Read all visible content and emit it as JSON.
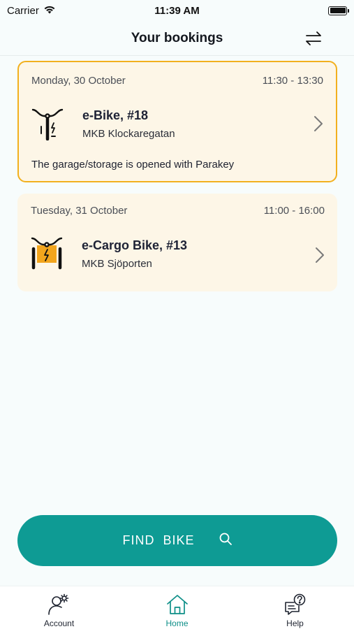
{
  "status_bar": {
    "carrier": "Carrier",
    "time": "11:39 AM",
    "battery_level": 1.0
  },
  "header": {
    "title": "Your bookings",
    "swap_icon": "swap-arrows-icon"
  },
  "bookings": [
    {
      "date": "Monday, 30 October",
      "time": "11:30 - 13:30",
      "bike": "e-Bike, #18",
      "location": "MKB Klockaregatan",
      "note": "The garage/storage is opened with Parakey",
      "icon": "e-bike-icon",
      "selected": true
    },
    {
      "date": "Tuesday, 31 October",
      "time": "11:00 - 16:00",
      "bike": "e-Cargo Bike, #13",
      "location": "MKB Sjöporten",
      "icon": "e-cargo-bike-icon",
      "selected": false
    }
  ],
  "find_button": {
    "label": "FIND  BIKE",
    "icon": "search-icon"
  },
  "tabs": [
    {
      "label": "Account",
      "icon": "account-settings-icon",
      "active": false
    },
    {
      "label": "Home",
      "icon": "home-icon",
      "active": true
    },
    {
      "label": "Help",
      "icon": "help-chat-icon",
      "active": false
    }
  ],
  "colors": {
    "accent": "#0e9b94",
    "card_bg": "#fdf6e7",
    "selected_border": "#f2b01e",
    "bike_orange": "#f2a51d"
  }
}
